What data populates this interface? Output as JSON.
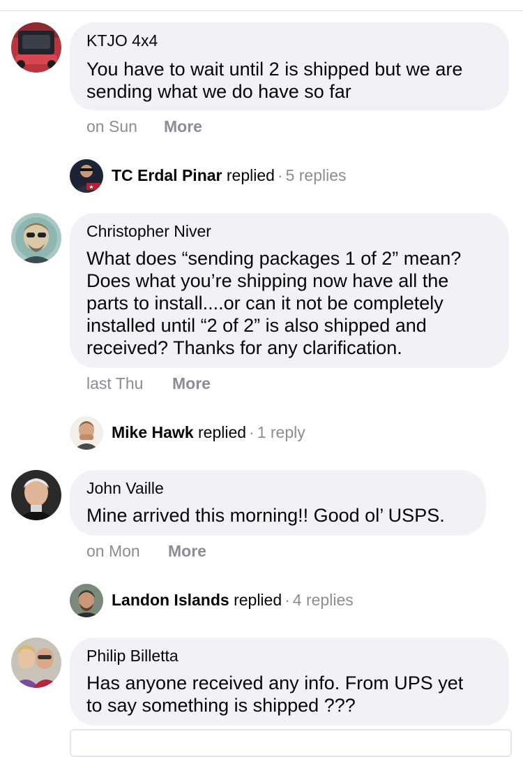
{
  "comments": [
    {
      "author": "KTJO 4x4",
      "lines": [
        "You have to wait until 2 is shipped but we are",
        "sending what we do have so far"
      ],
      "time": "on Sun",
      "more": "More",
      "reply_summary": {
        "name": "TC Erdal Pinar",
        "verb": "replied",
        "count": "5 replies"
      }
    },
    {
      "author": "Christopher Niver",
      "lines": [
        "What does “sending packages 1 of 2” mean?",
        "Does what you’re shipping now have all the",
        "parts to install....or can it not be completely",
        "installed until “2 of 2” is also shipped and",
        "received? Thanks for any clarification."
      ],
      "time": "last Thu",
      "more": "More",
      "reply_summary": {
        "name": "Mike Hawk",
        "verb": "replied",
        "count": "1 reply"
      }
    },
    {
      "author": "John Vaille",
      "lines": [
        "Mine arrived this morning!! Good ol’ USPS."
      ],
      "time": "on Mon",
      "more": "More",
      "reply_summary": {
        "name": "Landon Islands",
        "verb": "replied",
        "count": "4 replies"
      }
    },
    {
      "author": "Philip Billetta",
      "lines": [
        "Has anyone received any info. From UPS yet",
        "to say something is shipped ???"
      ]
    }
  ],
  "separator": "·",
  "colors": {
    "bubble": "#f0f2f5",
    "meta": "#8a8d91",
    "text": "#050505",
    "divider": "#dddfe2"
  }
}
